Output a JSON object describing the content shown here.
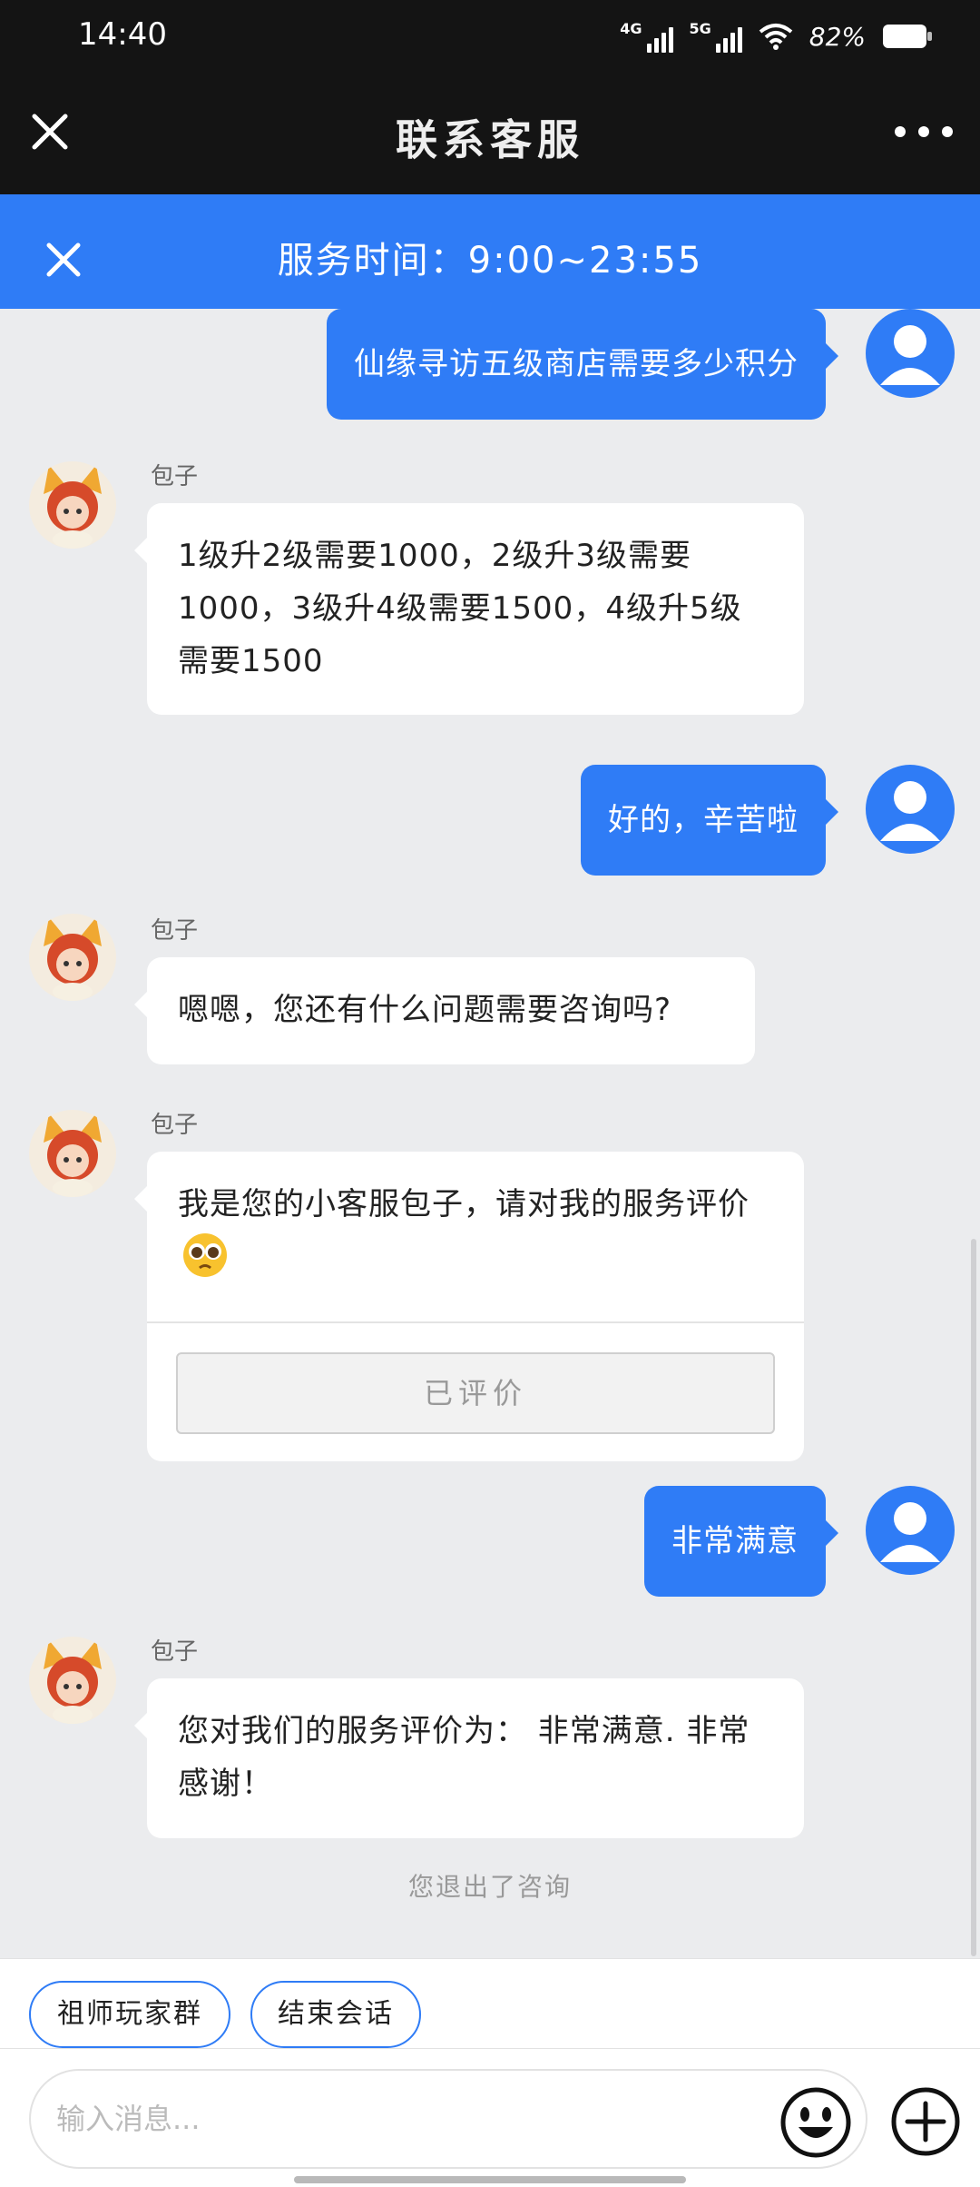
{
  "status_bar": {
    "time": "14:40",
    "network_1": "4G",
    "network_2": "5G",
    "battery": "82%"
  },
  "header": {
    "title": "联系客服"
  },
  "banner": {
    "text": "服务时间：9:00~23:55"
  },
  "messages": [
    {
      "from": "user",
      "text": "仙缘寻访五级商店需要多少积分"
    },
    {
      "from": "agent",
      "name": "包子",
      "text": "1级升2级需要1000，2级升3级需要1000，3级升4级需要1500，4级升5级需要1500"
    },
    {
      "from": "user",
      "text": "好的，辛苦啦"
    },
    {
      "from": "agent",
      "name": "包子",
      "text": "嗯嗯，您还有什么问题需要咨询吗?"
    },
    {
      "from": "agent",
      "name": "包子",
      "text": "我是您的小客服包子，请对我的服务评价",
      "button": "已评价"
    },
    {
      "from": "user",
      "text": "非常满意"
    },
    {
      "from": "agent",
      "name": "包子",
      "text": "您对我们的服务评价为： 非常满意. 非常感谢！"
    }
  ],
  "system_note": "您退出了咨询",
  "quick_actions": [
    "祖师玩家群",
    "结束会话"
  ],
  "input": {
    "placeholder": "输入消息..."
  },
  "colors": {
    "accent": "#2f7cf6",
    "background": "#ebecee",
    "header": "#141414"
  },
  "icons": [
    "close-icon",
    "more-icon",
    "user-avatar-icon",
    "agent-avatar",
    "emoji-icon",
    "plus-icon",
    "wifi-icon",
    "battery-icon",
    "pleading-face-emoji"
  ]
}
